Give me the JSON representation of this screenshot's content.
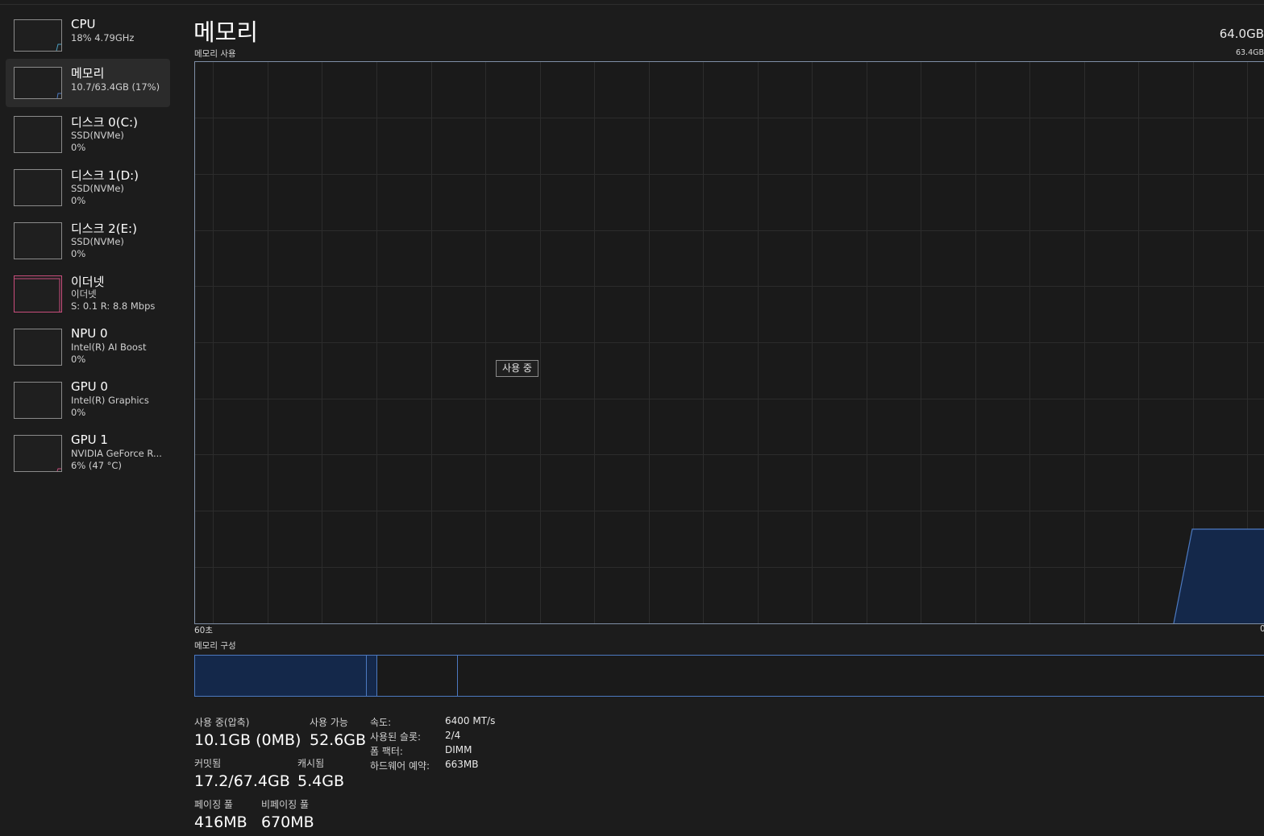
{
  "sidebar": {
    "items": [
      {
        "title": "CPU",
        "sub1": "18% 4.79GHz",
        "sub2": ""
      },
      {
        "title": "메모리",
        "sub1": "10.7/63.4GB (17%)",
        "sub2": ""
      },
      {
        "title": "디스크 0(C:)",
        "sub1": "SSD(NVMe)",
        "sub2": "0%"
      },
      {
        "title": "디스크 1(D:)",
        "sub1": "SSD(NVMe)",
        "sub2": "0%"
      },
      {
        "title": "디스크 2(E:)",
        "sub1": "SSD(NVMe)",
        "sub2": "0%"
      },
      {
        "title": "이더넷",
        "sub1": "이더넷",
        "sub2": "S: 0.1  R: 8.8 Mbps"
      },
      {
        "title": "NPU 0",
        "sub1": "Intel(R) AI Boost",
        "sub2": "0%"
      },
      {
        "title": "GPU 0",
        "sub1": "Intel(R) Graphics",
        "sub2": "0%"
      },
      {
        "title": "GPU 1",
        "sub1": "NVIDIA GeForce R...",
        "sub2": "6% (47 °C)"
      }
    ]
  },
  "main": {
    "title": "메모리",
    "total": "64.0GB",
    "usage_label": "메모리 사용",
    "usage_max": "63.4GB",
    "axis_left": "60초",
    "axis_right": "0",
    "tooltip": "사용 중",
    "composition_label": "메모리 구성"
  },
  "colors": {
    "accent": "#4c79c0",
    "fill": "#14284a",
    "ethernet": "#c94d7c"
  },
  "stats": {
    "in_use_label": "사용 중(압축)",
    "in_use_value": "10.1GB (0MB)",
    "available_label": "사용 가능",
    "available_value": "52.6GB",
    "committed_label": "커밋됨",
    "committed_value": "17.2/67.4GB",
    "cached_label": "캐시됨",
    "cached_value": "5.4GB",
    "paged_label": "페이징 풀",
    "paged_value": "416MB",
    "nonpaged_label": "비페이징 풀",
    "nonpaged_value": "670MB"
  },
  "specs": [
    {
      "label": "속도:",
      "value": "6400 MT/s"
    },
    {
      "label": "사용된 슬롯:",
      "value": "2/4"
    },
    {
      "label": "폼 팩터:",
      "value": "DIMM"
    },
    {
      "label": "하드웨어 예약:",
      "value": "663MB"
    }
  ]
}
